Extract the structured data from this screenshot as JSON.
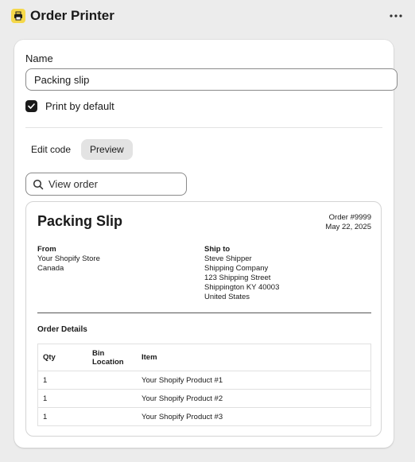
{
  "header": {
    "title": "Order Printer",
    "app_icon": "printer-icon",
    "more_icon": "more-horizontal-icon"
  },
  "form": {
    "name_label": "Name",
    "name_value": "Packing slip",
    "checkbox_label": "Print by default",
    "checkbox_checked": true
  },
  "tabs": [
    {
      "label": "Edit code",
      "active": false
    },
    {
      "label": "Preview",
      "active": true
    }
  ],
  "view_order": {
    "label": "View order",
    "icon": "search-icon"
  },
  "slip": {
    "title": "Packing Slip",
    "order_number": "Order #9999",
    "order_date": "May 22, 2025",
    "from": {
      "heading": "From",
      "lines": [
        "Your Shopify Store",
        "Canada"
      ]
    },
    "ship_to": {
      "heading": "Ship to",
      "lines": [
        "Steve Shipper",
        "Shipping Company",
        "123 Shipping Street",
        "Shippington KY 40003",
        "United States"
      ]
    },
    "details_heading": "Order Details",
    "columns": [
      "Qty",
      "Bin Location",
      "Item"
    ],
    "rows": [
      {
        "qty": "1",
        "bin": "",
        "item": "Your Shopify Product #1"
      },
      {
        "qty": "1",
        "bin": "",
        "item": "Your Shopify Product #2"
      },
      {
        "qty": "1",
        "bin": "",
        "item": "Your Shopify Product #3"
      }
    ]
  },
  "colors": {
    "background": "#ececec",
    "card": "#ffffff",
    "app_icon_bg": "#f5d84a",
    "checkbox": "#1a1a1a",
    "active_tab": "#e3e3e3"
  }
}
